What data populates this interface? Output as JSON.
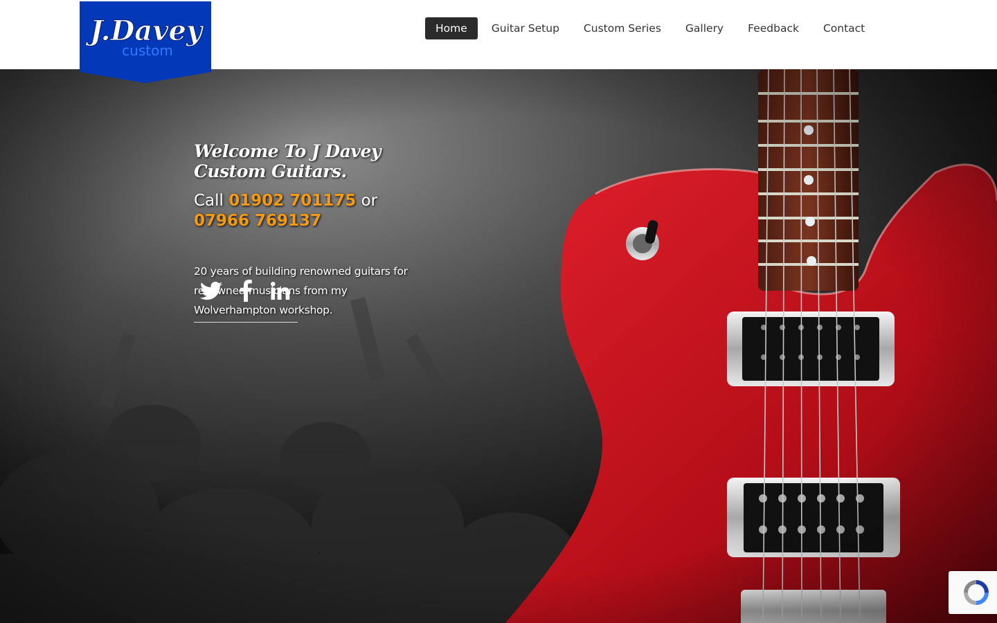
{
  "logo": {
    "line1": "J.Davey",
    "line2": "custom",
    "bg_color": "#0339b8"
  },
  "nav": {
    "items": [
      {
        "label": "Home",
        "active": true
      },
      {
        "label": "Guitar Setup",
        "active": false
      },
      {
        "label": "Custom Series",
        "active": false
      },
      {
        "label": "Gallery",
        "active": false
      },
      {
        "label": "Feedback",
        "active": false
      },
      {
        "label": "Contact",
        "active": false
      }
    ]
  },
  "hero": {
    "welcome": "Welcome To J Davey Custom Guitars.",
    "call_prefix": "Call",
    "phone1": "01902 701175",
    "call_or": "or",
    "phone2": "07966 769137",
    "description": "20 years of building renowned guitars for renowned musicians from my Wolverhampton workshop.",
    "phone_color": "#f39a12",
    "guitar_color": "#c8101c"
  },
  "social": [
    {
      "icon": "twitter-icon"
    },
    {
      "icon": "facebook-icon"
    },
    {
      "icon": "linkedin-icon"
    }
  ],
  "recaptcha": {
    "icon": "recaptcha-icon"
  }
}
